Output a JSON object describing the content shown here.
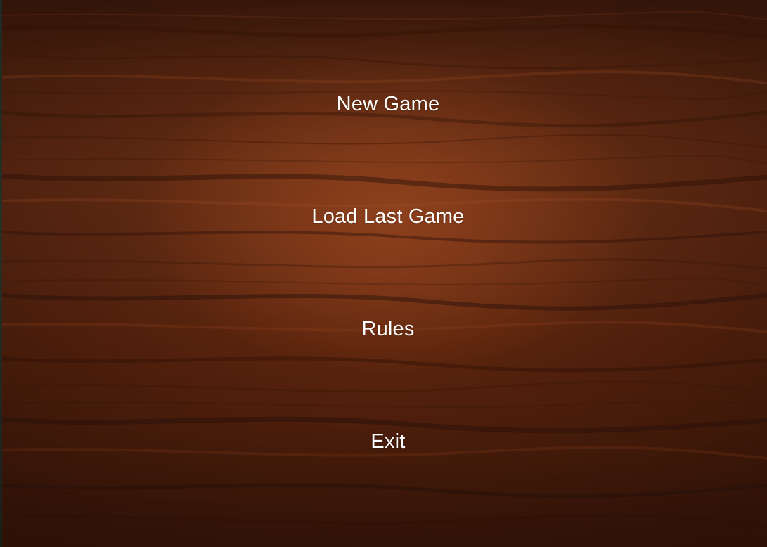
{
  "main_menu": {
    "items": [
      {
        "label": "New Game"
      },
      {
        "label": "Load Last Game"
      },
      {
        "label": "Rules"
      },
      {
        "label": "Exit"
      }
    ]
  },
  "theme": {
    "background": "wood-texture",
    "text_color": "#ffffff",
    "wood_base": "#6b2f14",
    "wood_dark": "#3a1a0c"
  }
}
